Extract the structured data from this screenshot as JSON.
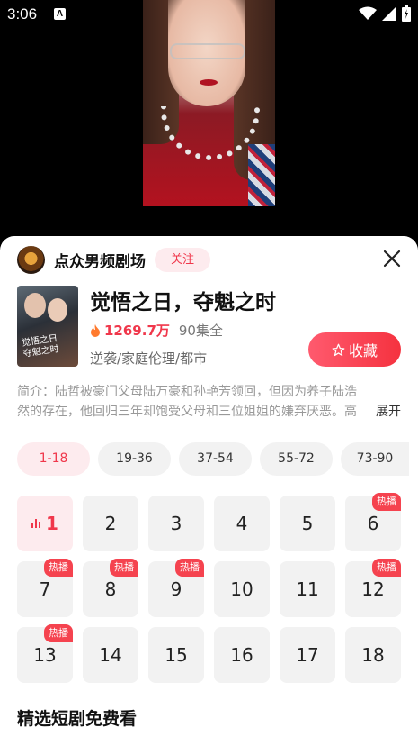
{
  "status_bar": {
    "time": "3:06",
    "indicator": "A",
    "icons": [
      "wifi-icon",
      "signal-icon",
      "battery-icon"
    ]
  },
  "channel": {
    "name": "点众男频剧场",
    "follow_label": "关注"
  },
  "drama": {
    "title": "觉悟之日，夺魁之时",
    "poster_text": "觉悟之日\n夺魁之时",
    "heat": "1269.7万",
    "episodes": "90集全",
    "tags": "逆袭/家庭伦理/都市",
    "collect_label": "收藏",
    "intro": "简介：陆哲被豪门父母陆万豪和孙艳芳领回，但因为养子陆浩然的存在，他回归三年却饱受父母和三位姐姐的嫌弃厌恶。高考完",
    "expand_label": "展开"
  },
  "range_tabs": [
    "1-18",
    "19-36",
    "37-54",
    "55-72",
    "73-90"
  ],
  "active_range": "1-18",
  "episodes": {
    "hot_label": "热播",
    "items": [
      {
        "num": "1",
        "playing": true,
        "hot": false
      },
      {
        "num": "2",
        "hot": false
      },
      {
        "num": "3",
        "hot": false
      },
      {
        "num": "4",
        "hot": false
      },
      {
        "num": "5",
        "hot": false
      },
      {
        "num": "6",
        "hot": true
      },
      {
        "num": "7",
        "hot": true
      },
      {
        "num": "8",
        "hot": true
      },
      {
        "num": "9",
        "hot": true
      },
      {
        "num": "10",
        "hot": false
      },
      {
        "num": "11",
        "hot": false
      },
      {
        "num": "12",
        "hot": true
      },
      {
        "num": "13",
        "hot": true
      },
      {
        "num": "14",
        "hot": false
      },
      {
        "num": "15",
        "hot": false
      },
      {
        "num": "16",
        "hot": false
      },
      {
        "num": "17",
        "hot": false
      },
      {
        "num": "18",
        "hot": false
      }
    ]
  },
  "section_title": "精选短剧免费看",
  "colors": {
    "accent": "#f0374b",
    "accent_bg": "#fdebee",
    "cell_bg": "#f2f2f2"
  }
}
